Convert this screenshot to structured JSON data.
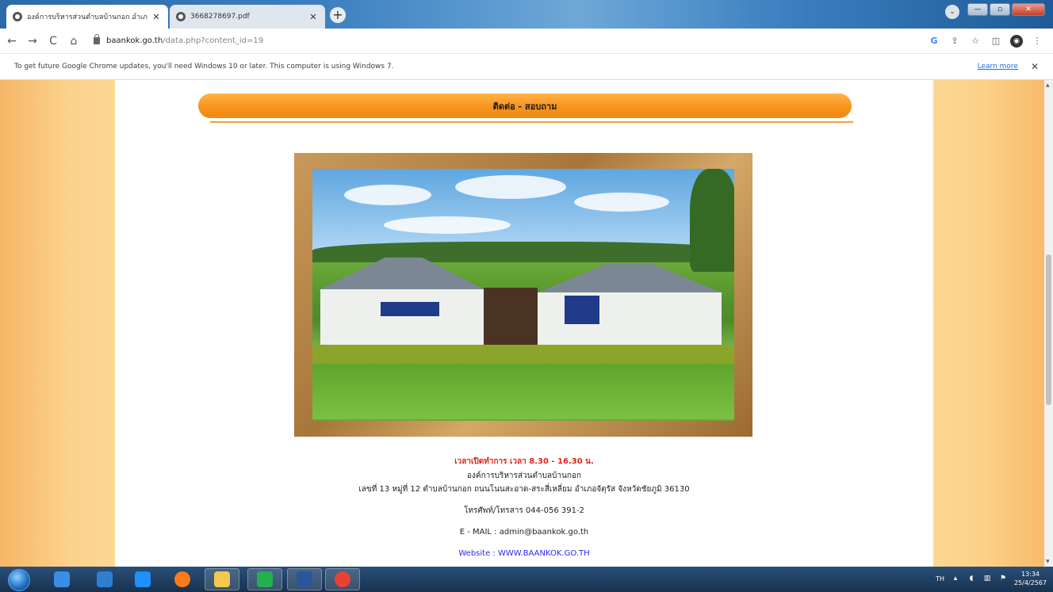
{
  "browser": {
    "tabs": [
      {
        "title": "องค์การบริหารส่วนตำบลบ้านกอก อำเภ",
        "active": true
      },
      {
        "title": "3668278697.pdf",
        "active": false
      }
    ],
    "new_tab_label": "+",
    "window_controls": {
      "minimize": "—",
      "maximize": "▫",
      "close": "✕"
    },
    "profile_icon": "⌄",
    "nav": {
      "back": "←",
      "forward": "→",
      "reload": "C",
      "home": "⌂"
    },
    "url": {
      "host": "baankok.go.th",
      "path": "/data.php?content_id=19"
    },
    "toolbar_icons": {
      "google": "G",
      "share": "⇪",
      "bookmark": "☆",
      "sidepanel": "◫",
      "menu": "⋮"
    },
    "infobar": {
      "message": "To get future Google Chrome updates, you'll need Windows 10 or later. This computer is using Windows 7.",
      "link": "Learn more",
      "close": "✕"
    }
  },
  "page": {
    "section_title": "ติดต่อ - สอบถาม",
    "office_hours": "เวลาเปิดทำการ เวลา 8.30 - 16.30 น.",
    "organization": "องค์การบริหารส่วนตำบลบ้านกอก",
    "address": "เลขที่ 13 หมู่ที่ 12 ตำบลบ้านกอก ถนนโนนสะอาด-สระสี่เหลี่ยม อำเภอจัตุรัส จังหวัดชัยภูมิ 36130",
    "phone": "โทรศัพท์/โทรสาร    044-056 391-2",
    "email": "E - MAIL : admin@baankok.go.th",
    "website": "Website : WWW.BAANKOK.GO.TH"
  },
  "taskbar": {
    "apps": [
      {
        "name": "media-center",
        "color": "#3a8ee6"
      },
      {
        "name": "windows-explorer",
        "color": "#2e7fd0"
      },
      {
        "name": "internet-explorer",
        "color": "#1e90ff"
      },
      {
        "name": "firefox",
        "color": "#ff7a1a"
      },
      {
        "name": "folder",
        "color": "#f2c94c"
      },
      {
        "name": "line",
        "color": "#22b14c"
      },
      {
        "name": "word",
        "color": "#2b579a"
      },
      {
        "name": "chrome",
        "color": "#e94235"
      }
    ],
    "tray": {
      "lang": "TH",
      "time": "13:34",
      "date": "25/4/2567"
    }
  },
  "colors": {
    "header_orange": "#f7941d",
    "hours_red": "#e0241b",
    "website_blue": "#2a2af0",
    "side_panel": "#fbd18c"
  }
}
